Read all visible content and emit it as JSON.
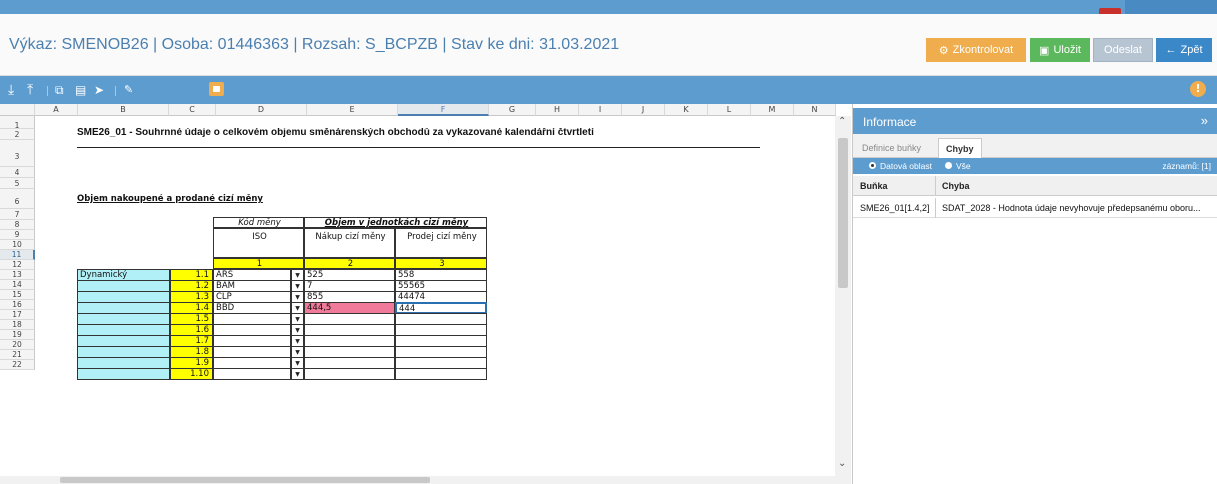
{
  "app": {
    "title": "Výkaz: SMENOB26 | Osoba: 01446363 | Rozsah: S_BCPZB | Stav ke dni: 31.03.2021"
  },
  "buttons": {
    "check": "Zkontrolovat",
    "save": "Uložit",
    "send": "Odeslat",
    "back": "Zpět"
  },
  "colors": {
    "accent": "#5d9ccf",
    "orange": "#f0ad4e",
    "green": "#5cb85c",
    "yellow_cell": "#ffff00",
    "cyan_cell": "#b2f0f7",
    "error_cell": "#f07a9a"
  },
  "sheet": {
    "columns": [
      "A",
      "B",
      "C",
      "D",
      "E",
      "F",
      "G",
      "H",
      "I",
      "J",
      "K",
      "L",
      "M",
      "N"
    ],
    "rows": [
      "1",
      "2",
      "3",
      "4",
      "5",
      "6",
      "7",
      "8",
      "9",
      "10",
      "11",
      "12",
      "13",
      "14",
      "15",
      "16",
      "17",
      "18",
      "19",
      "20",
      "21",
      "22"
    ],
    "title": "SME26_01 - Souhrnné údaje o celkovém objemu směnárenských obchodů za vykazované kalendářní čtvrtletí",
    "section": "Objem nakoupené a prodané cizí měny",
    "hdr_code": "Kód měny",
    "hdr_iso": "ISO",
    "hdr_volume": "Objem v jednotkách cizí měny",
    "hdr_buy": "Nákup cizí měny",
    "hdr_sell": "Prodej cizí měny",
    "colnums": [
      "1",
      "2",
      "3"
    ],
    "row_label": "Dynamický",
    "data_rows": [
      {
        "num": "1.1",
        "iso": "ARS",
        "buy": "525",
        "sell": "558"
      },
      {
        "num": "1.2",
        "iso": "BAM",
        "buy": "7",
        "sell": "55565"
      },
      {
        "num": "1.3",
        "iso": "CLP",
        "buy": "855",
        "sell": "44474"
      },
      {
        "num": "1.4",
        "iso": "BBD",
        "buy": "444,5",
        "sell": "444"
      },
      {
        "num": "1.5",
        "iso": "",
        "buy": "",
        "sell": ""
      },
      {
        "num": "1.6",
        "iso": "",
        "buy": "",
        "sell": ""
      },
      {
        "num": "1.7",
        "iso": "",
        "buy": "",
        "sell": ""
      },
      {
        "num": "1.8",
        "iso": "",
        "buy": "",
        "sell": ""
      },
      {
        "num": "1.9",
        "iso": "",
        "buy": "",
        "sell": ""
      },
      {
        "num": "1.10",
        "iso": "",
        "buy": "",
        "sell": ""
      }
    ]
  },
  "panel": {
    "title": "Informace",
    "tab_def": "Definice buňky",
    "tab_err": "Chyby",
    "radio_data": "Datová oblast",
    "radio_all": "Vše",
    "count": "záznamů: [1]",
    "col_cell": "Buňka",
    "col_err": "Chyba",
    "err_cell": "SME26_01[1.4,2]",
    "err_text": "SDAT_2028 - Hodnota údaje nevyhovuje předepsanému oboru..."
  }
}
